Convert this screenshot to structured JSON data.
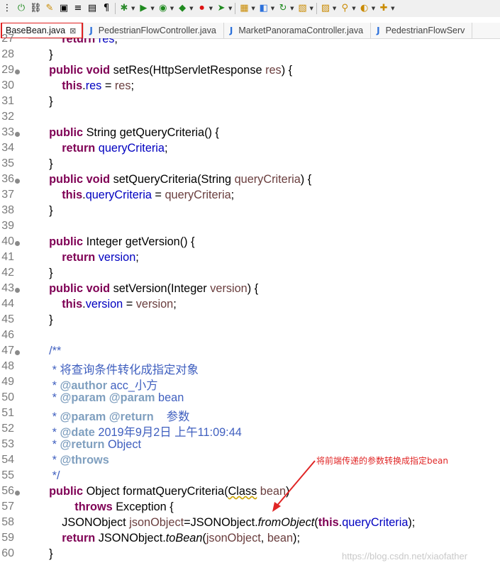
{
  "toolbar": {
    "icons": [
      "hierarchy-icon",
      "toggle-icon",
      "link-icon",
      "highlight-icon",
      "select-icon",
      "wrap-icon",
      "doc-icon",
      "pilcrow-icon",
      "debug-icon",
      "run-icon",
      "profile-icon",
      "coverage-icon",
      "stop-icon",
      "external-icon",
      "new-package-icon",
      "new-class-icon",
      "refresh-icon",
      "open-type-icon",
      "open-task-icon",
      "search-icon",
      "team-icon",
      "annotate-icon"
    ]
  },
  "tabs": [
    {
      "label": "BaseBean.java",
      "active": true,
      "close": "⊠"
    },
    {
      "label": "PedestrianFlowController.java",
      "active": false,
      "icon": "J"
    },
    {
      "label": "MarketPanoramaController.java",
      "active": false,
      "icon": "J"
    },
    {
      "label": "PedestrianFlowServ",
      "active": false,
      "icon": "J"
    }
  ],
  "code_lines": [
    {
      "num": "27",
      "fold": false,
      "segs": [
        [
          "",
          "        "
        ],
        [
          "kw",
          "return"
        ],
        [
          "",
          " "
        ],
        [
          "fld",
          "res"
        ],
        [
          "",
          ";"
        ]
      ]
    },
    {
      "num": "28",
      "fold": false,
      "segs": [
        [
          "",
          "    }"
        ]
      ]
    },
    {
      "num": "29",
      "fold": true,
      "segs": [
        [
          "",
          "    "
        ],
        [
          "kw",
          "public"
        ],
        [
          "",
          " "
        ],
        [
          "kw",
          "void"
        ],
        [
          "",
          " setRes(HttpServletResponse "
        ],
        [
          "prm",
          "res"
        ],
        [
          "",
          ") {"
        ]
      ]
    },
    {
      "num": "30",
      "fold": false,
      "segs": [
        [
          "",
          "        "
        ],
        [
          "kw",
          "this"
        ],
        [
          "",
          "."
        ],
        [
          "fld",
          "res"
        ],
        [
          "",
          " = "
        ],
        [
          "prm",
          "res"
        ],
        [
          "",
          ";"
        ]
      ]
    },
    {
      "num": "31",
      "fold": false,
      "segs": [
        [
          "",
          "    }"
        ]
      ]
    },
    {
      "num": "32",
      "fold": false,
      "segs": [
        [
          "",
          ""
        ]
      ]
    },
    {
      "num": "33",
      "fold": true,
      "segs": [
        [
          "",
          "    "
        ],
        [
          "kw",
          "public"
        ],
        [
          "",
          " String getQueryCriteria() {"
        ]
      ]
    },
    {
      "num": "34",
      "fold": false,
      "segs": [
        [
          "",
          "        "
        ],
        [
          "kw",
          "return"
        ],
        [
          "",
          " "
        ],
        [
          "fld",
          "queryCriteria"
        ],
        [
          "",
          ";"
        ]
      ]
    },
    {
      "num": "35",
      "fold": false,
      "segs": [
        [
          "",
          "    }"
        ]
      ]
    },
    {
      "num": "36",
      "fold": true,
      "segs": [
        [
          "",
          "    "
        ],
        [
          "kw",
          "public"
        ],
        [
          "",
          " "
        ],
        [
          "kw",
          "void"
        ],
        [
          "",
          " setQueryCriteria(String "
        ],
        [
          "prm",
          "queryCriteria"
        ],
        [
          "",
          ") {"
        ]
      ]
    },
    {
      "num": "37",
      "fold": false,
      "segs": [
        [
          "",
          "        "
        ],
        [
          "kw",
          "this"
        ],
        [
          "",
          "."
        ],
        [
          "fld",
          "queryCriteria"
        ],
        [
          "",
          " = "
        ],
        [
          "prm",
          "queryCriteria"
        ],
        [
          "",
          ";"
        ]
      ]
    },
    {
      "num": "38",
      "fold": false,
      "segs": [
        [
          "",
          "    }"
        ]
      ]
    },
    {
      "num": "39",
      "fold": false,
      "segs": [
        [
          "",
          ""
        ]
      ]
    },
    {
      "num": "40",
      "fold": true,
      "segs": [
        [
          "",
          "    "
        ],
        [
          "kw",
          "public"
        ],
        [
          "",
          " Integer getVersion() {"
        ]
      ]
    },
    {
      "num": "41",
      "fold": false,
      "segs": [
        [
          "",
          "        "
        ],
        [
          "kw",
          "return"
        ],
        [
          "",
          " "
        ],
        [
          "fld",
          "version"
        ],
        [
          "",
          ";"
        ]
      ]
    },
    {
      "num": "42",
      "fold": false,
      "segs": [
        [
          "",
          "    }"
        ]
      ]
    },
    {
      "num": "43",
      "fold": true,
      "segs": [
        [
          "",
          "    "
        ],
        [
          "kw",
          "public"
        ],
        [
          "",
          " "
        ],
        [
          "kw",
          "void"
        ],
        [
          "",
          " setVersion(Integer "
        ],
        [
          "prm",
          "version"
        ],
        [
          "",
          ") {"
        ]
      ]
    },
    {
      "num": "44",
      "fold": false,
      "segs": [
        [
          "",
          "        "
        ],
        [
          "kw",
          "this"
        ],
        [
          "",
          "."
        ],
        [
          "fld",
          "version"
        ],
        [
          "",
          " = "
        ],
        [
          "prm",
          "version"
        ],
        [
          "",
          ";"
        ]
      ]
    },
    {
      "num": "45",
      "fold": false,
      "segs": [
        [
          "",
          "    }"
        ]
      ]
    },
    {
      "num": "46",
      "fold": false,
      "segs": [
        [
          "",
          ""
        ]
      ]
    },
    {
      "num": "47",
      "fold": true,
      "segs": [
        [
          "",
          "    "
        ],
        [
          "cmt",
          "/**"
        ]
      ]
    },
    {
      "num": "48",
      "fold": false,
      "segs": [
        [
          "",
          "     "
        ],
        [
          "cmt",
          "* 将查询条件转化成指定对象"
        ]
      ]
    },
    {
      "num": "49",
      "fold": false,
      "segs": [
        [
          "",
          "     "
        ],
        [
          "cmt",
          "* "
        ],
        [
          "tag",
          "@author"
        ],
        [
          "cmt",
          " acc_小方"
        ]
      ]
    },
    {
      "num": "50",
      "fold": false,
      "segs": [
        [
          "",
          "     "
        ],
        [
          "cmt",
          "* "
        ],
        [
          "tag",
          "@param"
        ],
        [
          "cmt",
          " "
        ],
        [
          "tag",
          "@param"
        ],
        [
          "cmt",
          " bean"
        ]
      ]
    },
    {
      "num": "51",
      "fold": false,
      "segs": [
        [
          "",
          "     "
        ],
        [
          "cmt",
          "* "
        ],
        [
          "tag",
          "@param"
        ],
        [
          "cmt",
          " "
        ],
        [
          "tag",
          "@return"
        ],
        [
          "cmt",
          "    参数"
        ]
      ]
    },
    {
      "num": "52",
      "fold": false,
      "segs": [
        [
          "",
          "     "
        ],
        [
          "cmt",
          "* "
        ],
        [
          "tag",
          "@date"
        ],
        [
          "cmt",
          " 2019年9月2日 上午11:09:44"
        ]
      ]
    },
    {
      "num": "53",
      "fold": false,
      "segs": [
        [
          "",
          "     "
        ],
        [
          "cmt",
          "* "
        ],
        [
          "tag",
          "@return"
        ],
        [
          "cmt",
          " Object"
        ]
      ]
    },
    {
      "num": "54",
      "fold": false,
      "segs": [
        [
          "",
          "     "
        ],
        [
          "cmt",
          "* "
        ],
        [
          "tag",
          "@throws"
        ]
      ]
    },
    {
      "num": "55",
      "fold": false,
      "segs": [
        [
          "",
          "     "
        ],
        [
          "cmt",
          "*/"
        ]
      ]
    },
    {
      "num": "56",
      "fold": true,
      "segs": [
        [
          "",
          "    "
        ],
        [
          "kw",
          "public"
        ],
        [
          "",
          " Object formatQueryCriteria("
        ],
        [
          "warn",
          "Class"
        ],
        [
          "",
          " "
        ],
        [
          "prm",
          "bean"
        ],
        [
          "",
          ")"
        ]
      ]
    },
    {
      "num": "57",
      "fold": false,
      "segs": [
        [
          "",
          "            "
        ],
        [
          "kw",
          "throws"
        ],
        [
          "",
          " Exception {"
        ]
      ]
    },
    {
      "num": "58",
      "fold": false,
      "segs": [
        [
          "",
          "        JSONObject "
        ],
        [
          "prm",
          "jsonObject"
        ],
        [
          "",
          "=JSONObject."
        ],
        [
          "it",
          "fromObject"
        ],
        [
          "",
          "("
        ],
        [
          "kw",
          "this"
        ],
        [
          "",
          "."
        ],
        [
          "fld",
          "queryCriteria"
        ],
        [
          "",
          ");"
        ]
      ]
    },
    {
      "num": "59",
      "fold": false,
      "segs": [
        [
          "",
          "        "
        ],
        [
          "kw",
          "return"
        ],
        [
          "",
          " JSONObject."
        ],
        [
          "it",
          "toBean"
        ],
        [
          "",
          "("
        ],
        [
          "prm",
          "jsonObject"
        ],
        [
          "",
          ", "
        ],
        [
          "prm",
          "bean"
        ],
        [
          "",
          ");"
        ]
      ]
    },
    {
      "num": "60",
      "fold": false,
      "segs": [
        [
          "",
          "    }"
        ]
      ]
    }
  ],
  "annotation": {
    "text": "将前端传递的参数转换成指定bean",
    "color": "#e02525"
  },
  "watermark": "https://blog.csdn.net/xiaofather",
  "colors": {
    "keyword": "#7f0055",
    "field": "#0000c0",
    "param": "#6a3e3e",
    "comment": "#3f5fbf",
    "javadoc_tag": "#7f9fbf",
    "line_number": "#7a7a7a",
    "highlight_box": "#e02020"
  }
}
